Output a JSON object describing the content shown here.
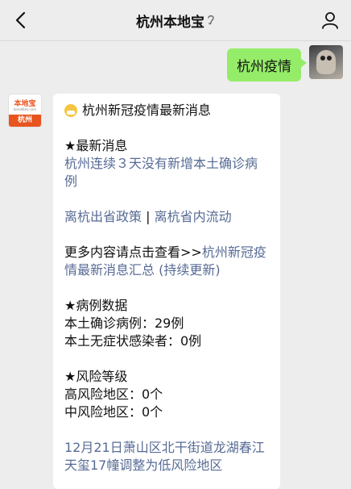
{
  "header": {
    "title": "杭州本地宝",
    "ear_glyph": "?"
  },
  "outgoing": {
    "text": "杭州疫情"
  },
  "incoming": {
    "brand_name": "本地宝",
    "brand_url": "bendibao.com",
    "brand_city": "杭州",
    "title": "杭州新冠疫情最新消息",
    "section_latest": "★最新消息",
    "latest_link": "杭州连续３天没有新增本土确诊病例",
    "policy_link_1": "离杭出省政策",
    "policy_sep": "|",
    "policy_link_2": "离杭省内流动",
    "more_prefix": "更多内容请点击查看>>",
    "more_link": "杭州新冠疫情最新消息汇总 (持续更新)",
    "section_cases": "★病例数据",
    "cases_confirmed": "本土确诊病例：29例",
    "cases_asymptomatic": "本土无症状感染者：0例",
    "section_risk": "★风险等级",
    "risk_high": "高风险地区：0个",
    "risk_mid": "中风险地区：0个",
    "bottom_link": "12月21日萧山区北干街道龙湖春江天玺17幢调整为低风险地区"
  }
}
